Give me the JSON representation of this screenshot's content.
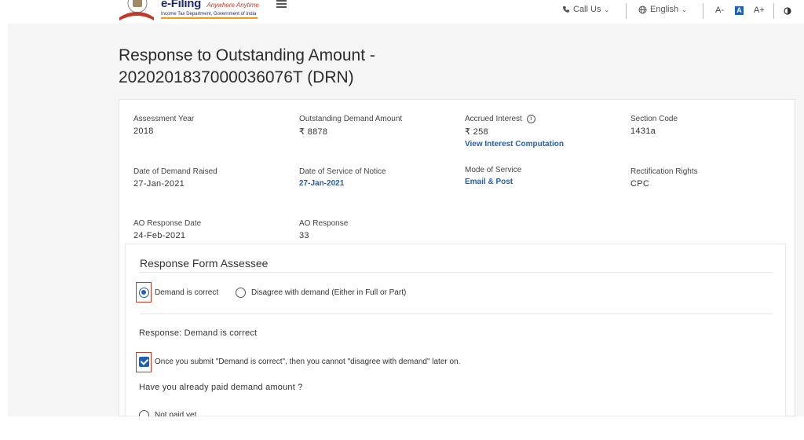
{
  "header": {
    "brand_main": "e-Filing",
    "brand_tag": "Anywhere Anytime",
    "brand_sub": "Income Tax Department, Government of India",
    "call_us": "Call Us",
    "language": "English",
    "font_decrease": "A-",
    "font_normal": "A",
    "font_increase": "A+",
    "accent": "#1f5fb4"
  },
  "page": {
    "title": "Response to Outstanding Amount - 2020201837000036076T (DRN)"
  },
  "details": {
    "assessment_year_label": "Assessment Year",
    "assessment_year": "2018",
    "outstanding_label": "Outstanding Demand Amount",
    "outstanding_value": "₹ 8878",
    "accrued_label": "Accrued Interest",
    "accrued_value": "₹ 258",
    "accrued_link": "View Interest Computation",
    "section_label": "Section Code",
    "section_value": "1431a",
    "demand_raised_label": "Date of Demand Raised",
    "demand_raised_value": "27-Jan-2021",
    "service_notice_label": "Date of Service of Notice",
    "service_notice_value": "27-Jan-2021",
    "mode_label": "Mode of Service",
    "mode_value": "Email & Post",
    "rectification_label": "Rectification Rights",
    "rectification_value": "CPC",
    "ao_date_label": "AO Response Date",
    "ao_date_value": "24-Feb-2021",
    "ao_response_label": "AO Response",
    "ao_response_value": "33"
  },
  "form": {
    "title": "Response Form Assessee",
    "option_correct": "Demand is correct",
    "option_disagree": "Disagree with demand (Either in Full or Part)",
    "response_text": "Response: Demand is correct",
    "confirm_text": "Once you submit \"Demand is correct\", then you cannot \"disagree with demand\" later on.",
    "paid_question": "Have you already paid demand amount ?",
    "not_paid_option": "Not paid yet"
  }
}
